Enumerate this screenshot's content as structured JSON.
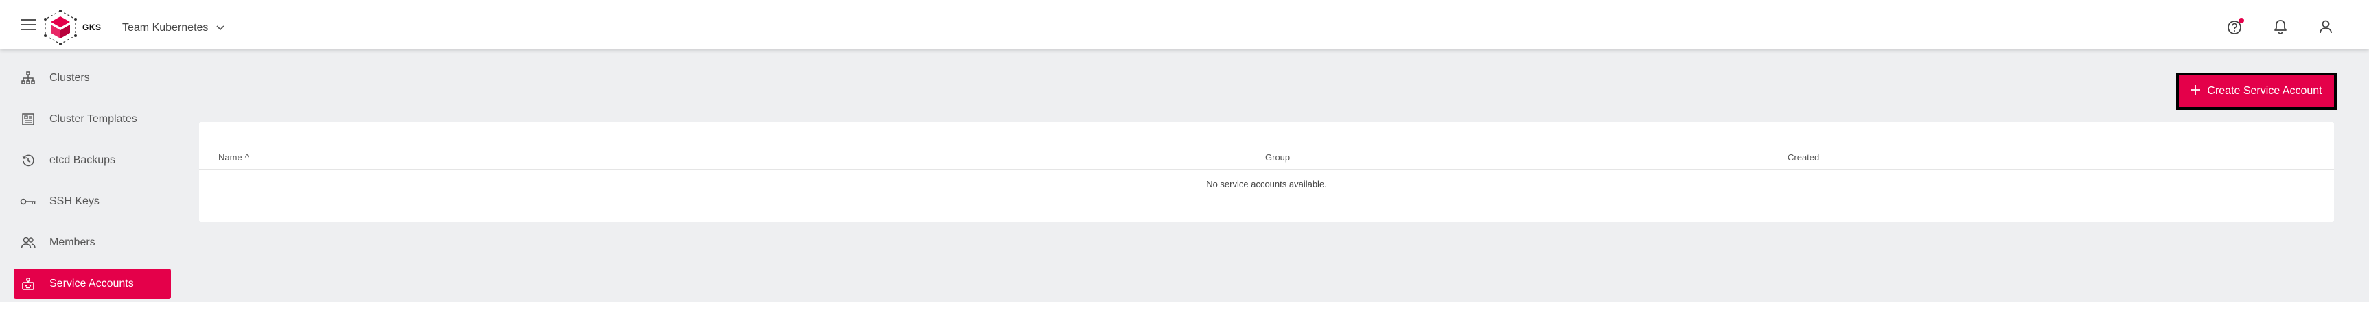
{
  "header": {
    "logo_text": "GKS",
    "project_name": "Team Kubernetes",
    "icons": [
      "menu-icon",
      "chevron-down-icon",
      "help-icon",
      "bell-icon",
      "account-icon"
    ],
    "accent": "#e4004a"
  },
  "sidebar": {
    "items": [
      {
        "label": "Clusters",
        "icon": "clusters-icon"
      },
      {
        "label": "Cluster Templates",
        "icon": "cluster-templates-icon"
      },
      {
        "label": "etcd Backups",
        "icon": "history-icon"
      },
      {
        "label": "SSH Keys",
        "icon": "key-icon"
      },
      {
        "label": "Members",
        "icon": "members-icon"
      },
      {
        "label": "Service Accounts",
        "icon": "service-accounts-icon",
        "active": true
      }
    ]
  },
  "main": {
    "create_button_label": "Create Service Account",
    "table": {
      "columns": [
        "Name",
        "Group",
        "Created"
      ],
      "sort_indicator": "^",
      "empty_text": "No service accounts available."
    }
  }
}
